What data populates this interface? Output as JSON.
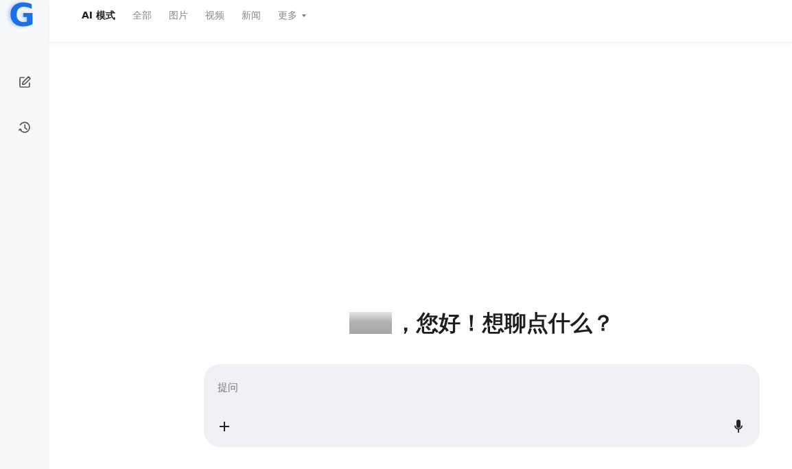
{
  "logo": {
    "text": "G"
  },
  "tabs": [
    {
      "label": "AI 模式",
      "selected": true
    },
    {
      "label": "全部",
      "selected": false
    },
    {
      "label": "图片",
      "selected": false
    },
    {
      "label": "视频",
      "selected": false
    },
    {
      "label": "新闻",
      "selected": false
    }
  ],
  "more_menu": {
    "label": "更多"
  },
  "greeting": {
    "name_redacted": true,
    "text": "，您好！想聊点什么？"
  },
  "composer": {
    "placeholder": "提问"
  }
}
